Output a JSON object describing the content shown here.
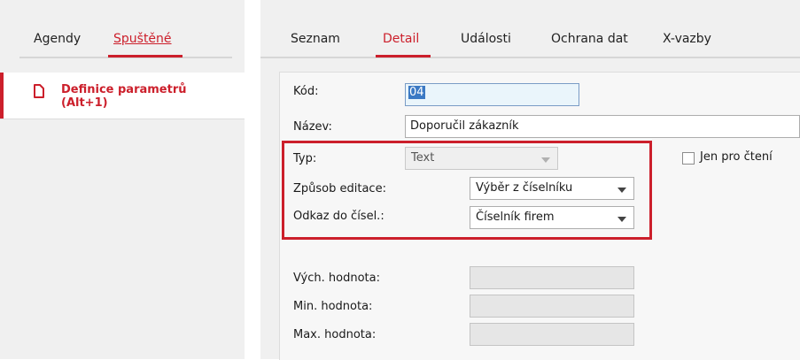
{
  "left_panel": {
    "tabs": [
      {
        "label": "Agendy",
        "active": false
      },
      {
        "label": "Spuštěné",
        "active": true
      }
    ],
    "items": [
      {
        "label": "Definice parametrů\n(Alt+1)",
        "icon": "document-icon"
      }
    ]
  },
  "right_panel": {
    "tabs": [
      {
        "label": "Seznam",
        "active": false
      },
      {
        "label": "Detail",
        "active": true
      },
      {
        "label": "Události",
        "active": false
      },
      {
        "label": "Ochrana dat",
        "active": false
      },
      {
        "label": "X-vazby",
        "active": false
      }
    ]
  },
  "form": {
    "kod": {
      "label": "Kód:",
      "value": "04"
    },
    "nazev": {
      "label": "Název:",
      "value": "Doporučil zákazník"
    },
    "typ": {
      "label": "Typ:",
      "value": "Text",
      "disabled": true
    },
    "jen_pro_cteni": {
      "label": "Jen pro čtení",
      "checked": false
    },
    "zpusob_editace": {
      "label": "Způsob editace:",
      "value": "Výběr z číselníku"
    },
    "odkaz": {
      "label": "Odkaz do čísel.:",
      "value": "Číselník firem"
    },
    "vych_hodnota": {
      "label": "Vých. hodnota:",
      "value": ""
    },
    "min_hodnota": {
      "label": "Min. hodnota:",
      "value": ""
    },
    "max_hodnota": {
      "label": "Max. hodnota:",
      "value": ""
    }
  },
  "colors": {
    "accent": "#cc1f2b",
    "panel_bg": "#f0f0f0",
    "selection": "#3b79c4"
  }
}
